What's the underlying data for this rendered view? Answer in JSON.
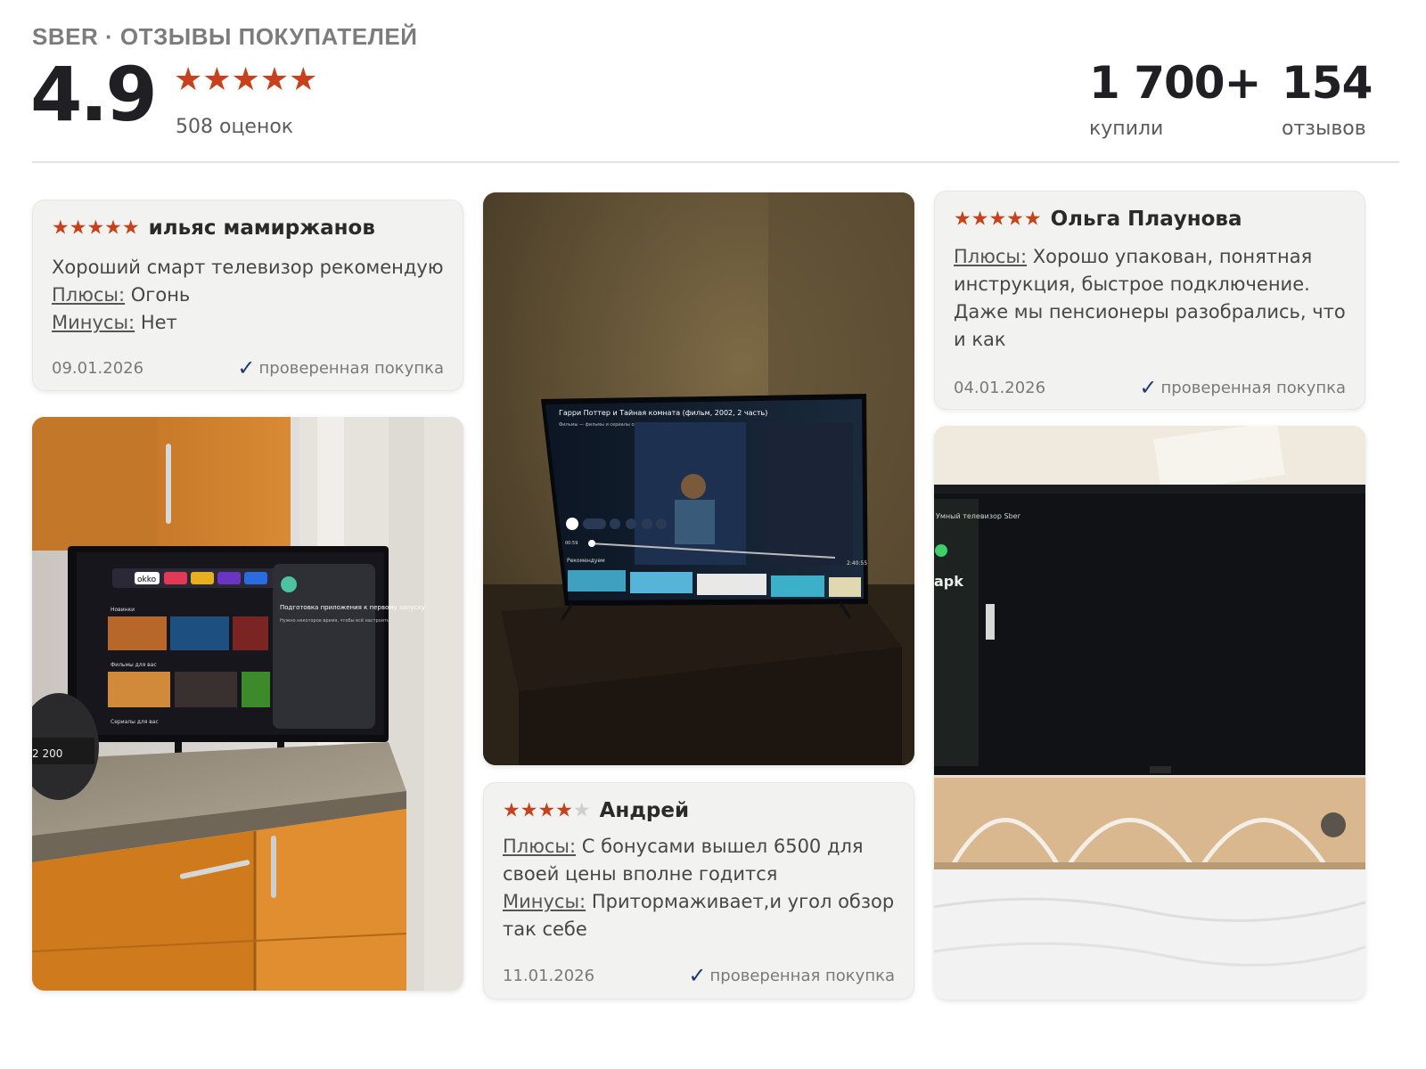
{
  "header": {
    "brand": "SBER · ОТЗЫВЫ ПОКУПАТЕЛЕЙ",
    "rating": "4.9",
    "stars": "★★★★★",
    "rating_count": "508 оценок",
    "stats": [
      {
        "value": "1 700+",
        "label": "купили"
      },
      {
        "value": "154",
        "label": "отзывов"
      }
    ]
  },
  "reviews": [
    {
      "stars": "★★★★★",
      "author": "ильяс мамиржанов",
      "text": "Хороший смарт телевизор рекомендую",
      "pros_label": "Плюсы:",
      "pros": "Огонь",
      "cons_label": "Минусы:",
      "cons": "Нет",
      "date": "09.01.2026",
      "verified": "проверенная покупка"
    },
    {
      "stars": "★★★★★",
      "author": "Ольга Плаунова",
      "pros_label": "Плюсы:",
      "pros": "Хорошо упакован, понятная инструкция, быстрое подключение. Даже мы пенсионеры разобрались, что и как",
      "date": "04.01.2026",
      "verified": "проверенная покупка"
    },
    {
      "stars": "★★★★",
      "stars_empty": "★",
      "author": "Андрей",
      "pros_label": "Плюсы:",
      "pros": "С бонусами вышел 6500   для своей цены вполне годится",
      "cons_label": "Минусы:",
      "cons": "Притормаживает,и угол обзор так себе",
      "date": "11.01.2026",
      "verified": "проверенная покупка"
    }
  ],
  "photos": {
    "kitchen_tv": {
      "apps": [
        "okko",
        "НОВИНКИ"
      ],
      "rows": [
        "Новинки",
        "Фильмы для вас",
        "Сериалы для вас"
      ],
      "dialog_title": "Подготовка приложения к первому запуску",
      "dialog_sub": "Нужно некоторое время, чтобы всё настроить",
      "device_text": "2 200"
    },
    "movie_tv": {
      "title": "Гарри Поттер и Тайная комната (фильм, 2002, 2 часть)",
      "subtitle": "Фильмы — фильмы и сериалы онлайн • 9,2 млн • 2 года назад",
      "time_start": "00:59",
      "time_end": "2:40:55",
      "row": "Рекомендуем"
    },
    "boxed_tv": {
      "box_text": "Умный телевизор Sber",
      "box_brand": "apk"
    }
  },
  "colors": {
    "accent_star": "#c7421c",
    "card_bg": "#f2f2f1",
    "check": "#1f3b73"
  }
}
